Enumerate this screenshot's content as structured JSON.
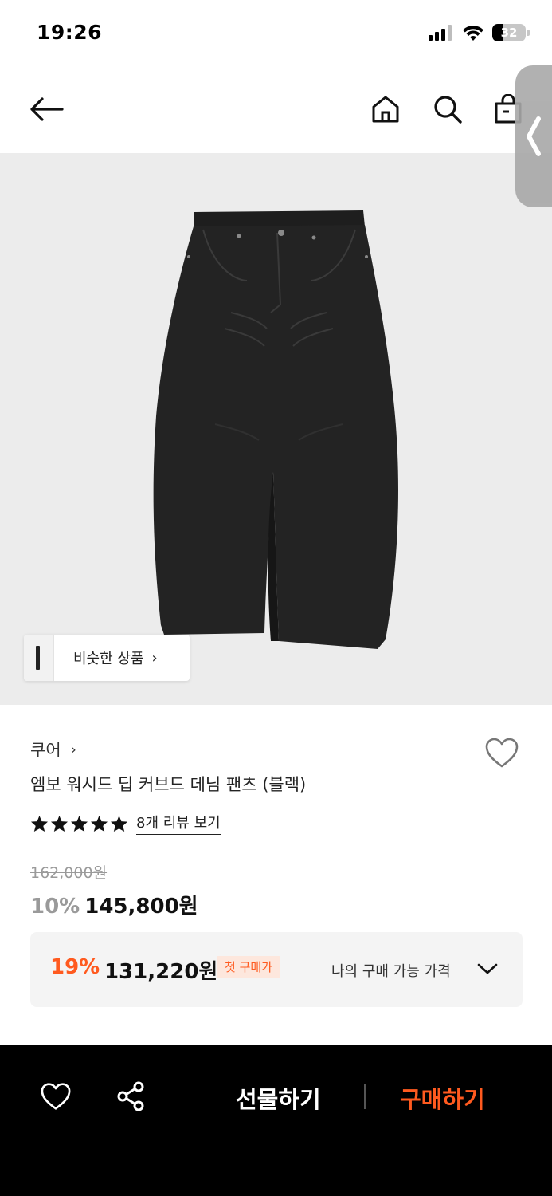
{
  "status_bar": {
    "time": "19:26",
    "battery": "32",
    "battery_level": 0.32,
    "icons": [
      "signal-icon",
      "wifi-icon",
      "battery-icon"
    ]
  },
  "header": {
    "icons": [
      "back-arrow-icon",
      "home-icon",
      "search-icon",
      "shopping-bag-icon"
    ]
  },
  "product_image": {
    "similar_button_label": "비슷한 상품",
    "similar_button_chevron": "›"
  },
  "product": {
    "brand": "쿠어",
    "brand_chevron": "›",
    "title": "엠보 워시드 딥 커브드 데님 팬츠 (블랙)",
    "rating_stars": 5,
    "review_link": "8개 리뷰 보기",
    "original_price": "162,000원",
    "discount": "10%",
    "price": "145,800원"
  },
  "coupon": {
    "discount": "19%",
    "price": "131,220원",
    "badge": "첫 구매가",
    "my_price_label": "나의 구매 가능 가격"
  },
  "bottom_bar": {
    "gift_label": "선물하기",
    "buy_label": "구매하기"
  },
  "colors": {
    "accent": "#ff5a1f",
    "bottom_bar_bg": "#000000",
    "image_bg": "#ececec",
    "coupon_bg": "#f4f4f4"
  }
}
